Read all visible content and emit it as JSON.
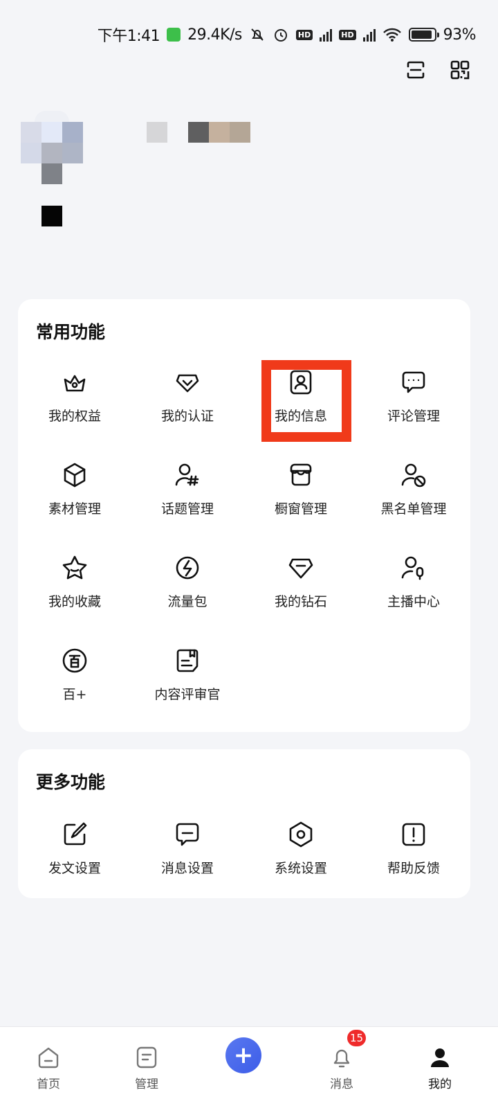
{
  "status_bar": {
    "time": "下午1:41",
    "speed": "29.4K/s",
    "hd1": "HD",
    "hd2": "HD",
    "net1": "5G",
    "net2": "5G",
    "battery": "93%",
    "battery_level": 0.93
  },
  "common": {
    "title": "常用功能",
    "items": [
      {
        "label": "我的权益",
        "icon": "crown-icon"
      },
      {
        "label": "我的认证",
        "icon": "shield-check-icon"
      },
      {
        "label": "我的信息",
        "icon": "id-card-icon"
      },
      {
        "label": "评论管理",
        "icon": "comment-icon"
      },
      {
        "label": "素材管理",
        "icon": "cube-icon"
      },
      {
        "label": "话题管理",
        "icon": "user-hashtag-icon"
      },
      {
        "label": "橱窗管理",
        "icon": "store-icon"
      },
      {
        "label": "黑名单管理",
        "icon": "user-block-icon"
      },
      {
        "label": "我的收藏",
        "icon": "star-icon"
      },
      {
        "label": "流量包",
        "icon": "lightning-icon"
      },
      {
        "label": "我的钻石",
        "icon": "diamond-icon"
      },
      {
        "label": "主播中心",
        "icon": "user-mic-icon"
      },
      {
        "label": "百+",
        "icon": "bai-plus-icon"
      },
      {
        "label": "内容评审官",
        "icon": "document-icon"
      }
    ]
  },
  "more": {
    "title": "更多功能",
    "items": [
      {
        "label": "发文设置",
        "icon": "edit-icon"
      },
      {
        "label": "消息设置",
        "icon": "message-icon"
      },
      {
        "label": "系统设置",
        "icon": "hexagon-settings-icon"
      },
      {
        "label": "帮助反馈",
        "icon": "exclamation-icon"
      }
    ]
  },
  "nav": {
    "home": "首页",
    "manage": "管理",
    "add": "+",
    "messages": "消息",
    "messages_badge": "15",
    "mine": "我的"
  },
  "colors": {
    "accent": "#3d5de8",
    "highlight": "#f03a1a",
    "badge": "#ef2b2b"
  }
}
